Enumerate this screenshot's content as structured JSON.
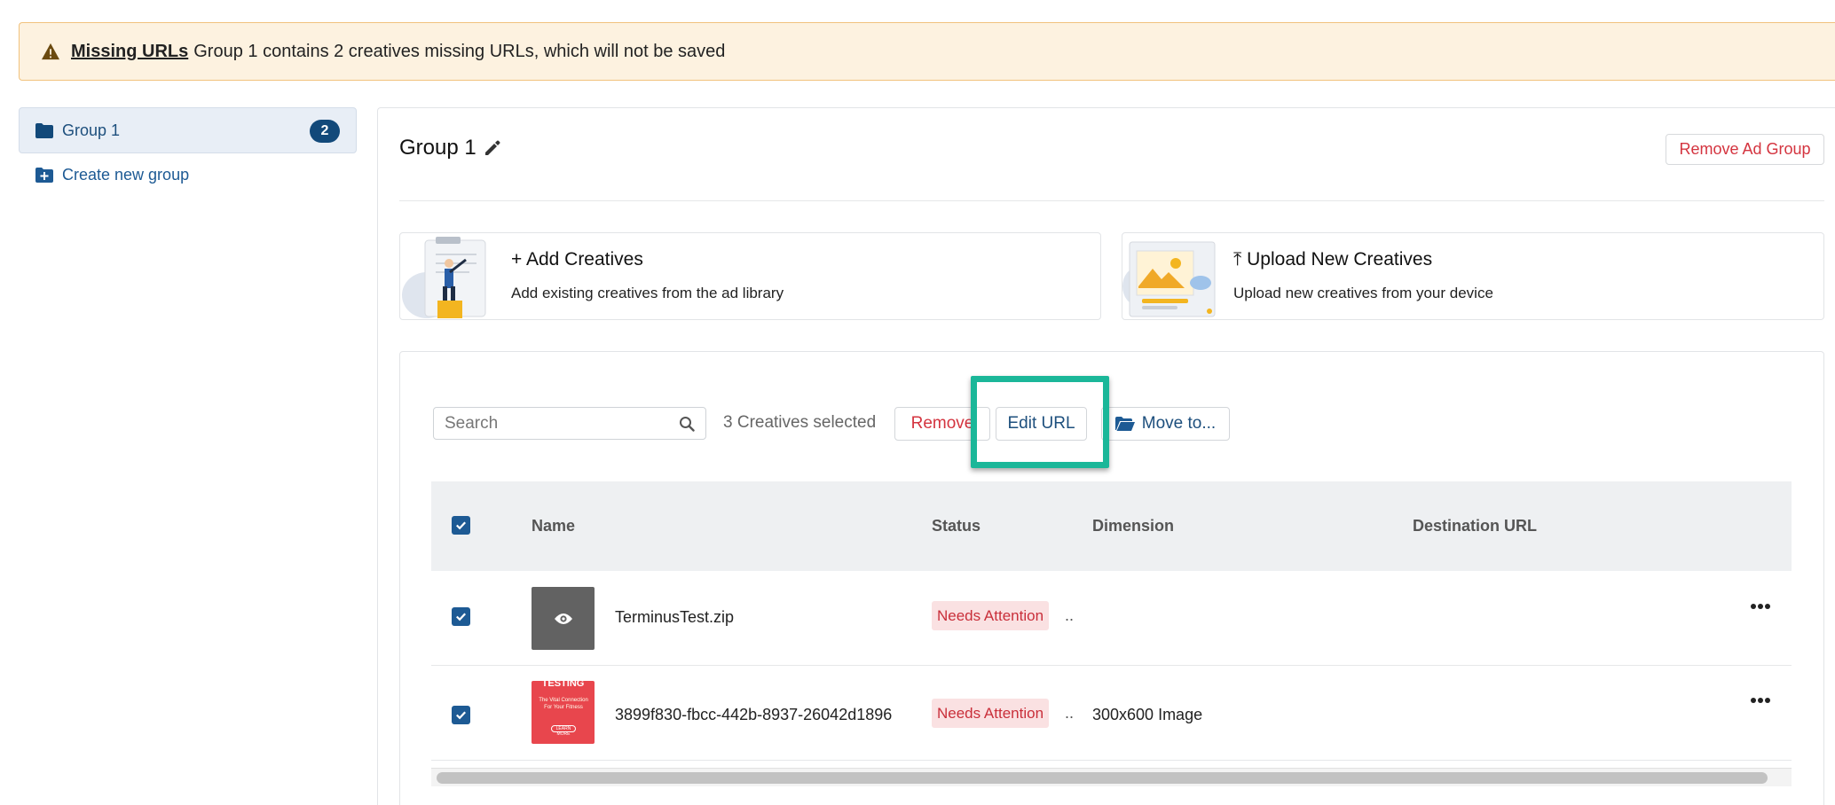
{
  "banner": {
    "title": "Missing URLs",
    "message": "Group 1 contains 2 creatives missing URLs, which will not be saved"
  },
  "sidebar": {
    "groups": [
      {
        "label": "Group 1",
        "count": "2"
      }
    ],
    "create_label": "Create new group"
  },
  "main": {
    "group_title": "Group 1",
    "remove_group_label": "Remove Ad Group",
    "add_card": {
      "title": "Add Creatives",
      "description": "Add existing creatives from the ad library"
    },
    "upload_card": {
      "title": "Upload New Creatives",
      "description": "Upload new creatives from your device"
    }
  },
  "toolbar": {
    "search_placeholder": "Search",
    "selected_text": "3 Creatives selected",
    "remove_label": "Remove",
    "edit_url_label": "Edit URL",
    "move_label": "Move to..."
  },
  "table": {
    "columns": [
      "Name",
      "Status",
      "Dimension",
      "Destination URL"
    ],
    "rows": [
      {
        "name": "TerminusTest.zip",
        "status": "Needs Attention",
        "trunc": "..",
        "dimension": "",
        "destination_url": ""
      },
      {
        "name": "3899f830-fbcc-442b-8937-26042d1896",
        "status": "Needs Attention",
        "trunc": "..",
        "dimension": "300x600 Image",
        "destination_url": "",
        "thumb_title": "TESTING",
        "thumb_sub": "The Vital Connection For Your Fitness",
        "thumb_btn": "LEARN MORE"
      }
    ]
  },
  "colors": {
    "accent": "#1d5a94",
    "danger": "#d4343f",
    "highlight": "#1bb799",
    "banner_bg": "#fdf2e0"
  }
}
